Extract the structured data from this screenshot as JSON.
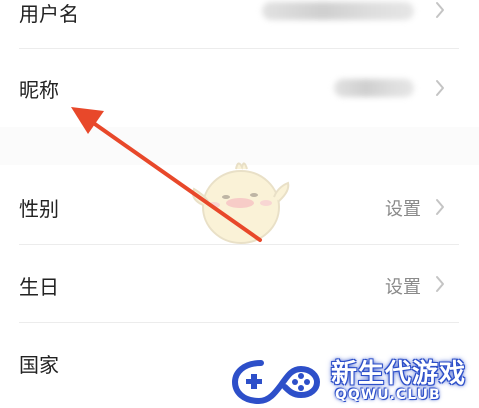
{
  "rows": [
    {
      "label": "用户名",
      "value": ""
    },
    {
      "label": "昵称",
      "value": ""
    },
    {
      "label": "性别",
      "value": "设置"
    },
    {
      "label": "生日",
      "value": "设置"
    },
    {
      "label": "国家",
      "value": ""
    }
  ],
  "watermark": {
    "title": "新生代游戏",
    "subtitle": "QQWU.CLUB"
  },
  "colors": {
    "arrow": "#e8482a",
    "divider": "#ececec",
    "label": "#222222",
    "value": "#8a8a8a",
    "watermark_blue": "#2d4fc9"
  },
  "icons": {
    "chevron": "chevron-right-icon",
    "mascot": "mascot-icon",
    "watermark_logo": "gamepad-icon"
  }
}
